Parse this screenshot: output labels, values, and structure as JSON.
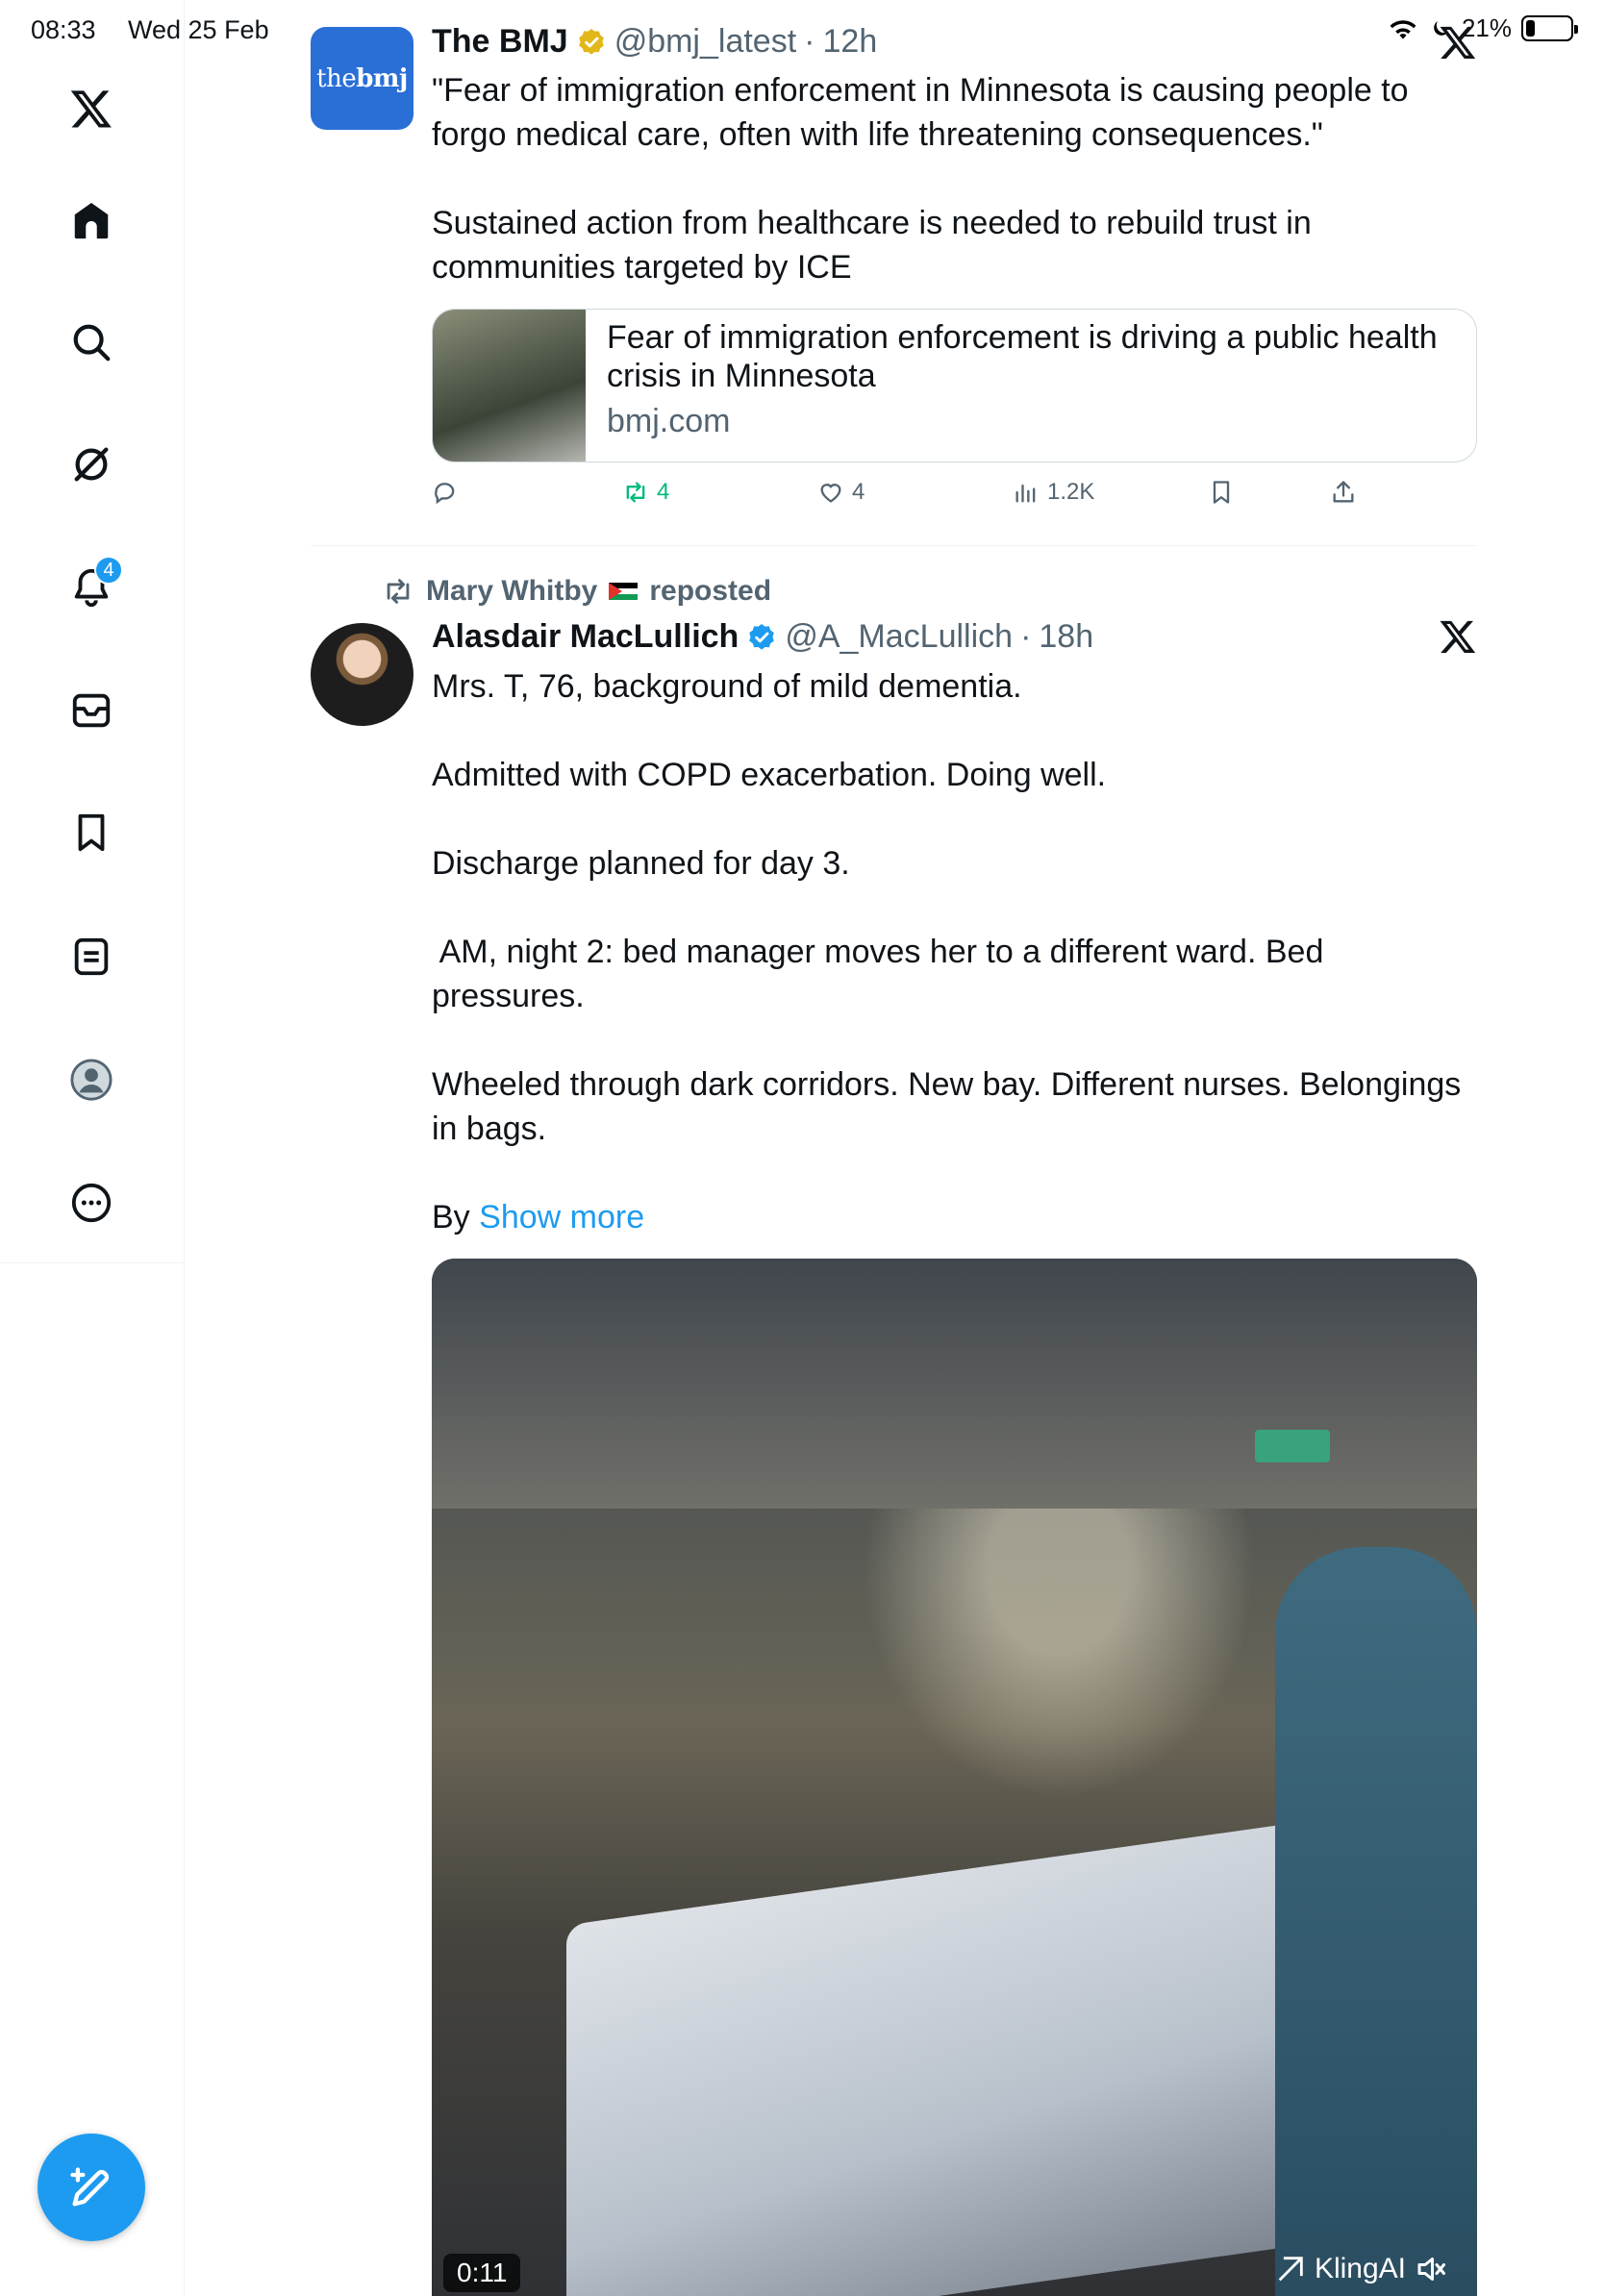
{
  "status_bar": {
    "time": "08:33",
    "date": "Wed 25 Feb",
    "battery": "21%",
    "battery_level": 0.21
  },
  "sidebar": {
    "notifications_badge": "4",
    "items": [
      "x-logo",
      "home",
      "search",
      "grok",
      "notifications",
      "messages",
      "bookmarks",
      "lists",
      "profile",
      "more"
    ]
  },
  "tweet1": {
    "display_name": "The BMJ",
    "handle": "@bmj_latest",
    "dot": "·",
    "time": "12h",
    "avatar_text_light": "the",
    "avatar_text_bold": "bmj",
    "text_lines": [
      "\"Fear of immigration enforcement in Minnesota is causing people to",
      "forgo medical care, often with life threatening consequences.\"",
      "",
      "Sustained action from healthcare is needed to rebuild trust in",
      "communities targeted by ICE"
    ],
    "card": {
      "title_line1": "Fear of immigration enforcement is driving a public health",
      "title_line2": "crisis in Minnesota",
      "domain": "bmj.com"
    },
    "actions": {
      "replies": "",
      "reposts": "4",
      "likes": "4",
      "views": "1.2K"
    }
  },
  "tweet2": {
    "reposted_by": "Mary Whitby",
    "reposted_label": "reposted",
    "display_name": "Alasdair MacLullich",
    "handle": "@A_MacLullich",
    "dot": "·",
    "time": "18h",
    "paragraphs": [
      "Mrs. T, 76, background of mild dementia.",
      "Admitted with COPD exacerbation. Doing well.",
      "Discharge planned for day 3.",
      " AM, night 2: bed manager moves her to a different ward. Bed",
      "pressures.",
      "Wheeled through dark corridors. New bay. Different nurses. Belongings",
      "in bags."
    ],
    "last_line_prefix": "By",
    "show_more": "Show more",
    "video": {
      "duration": "0:11",
      "watermark": "KlingAI"
    }
  },
  "colors": {
    "accent": "#1d9bf0",
    "retweet_green": "#00ba7c",
    "secondary_text": "#536471",
    "verified_gold": "#e2b719"
  }
}
